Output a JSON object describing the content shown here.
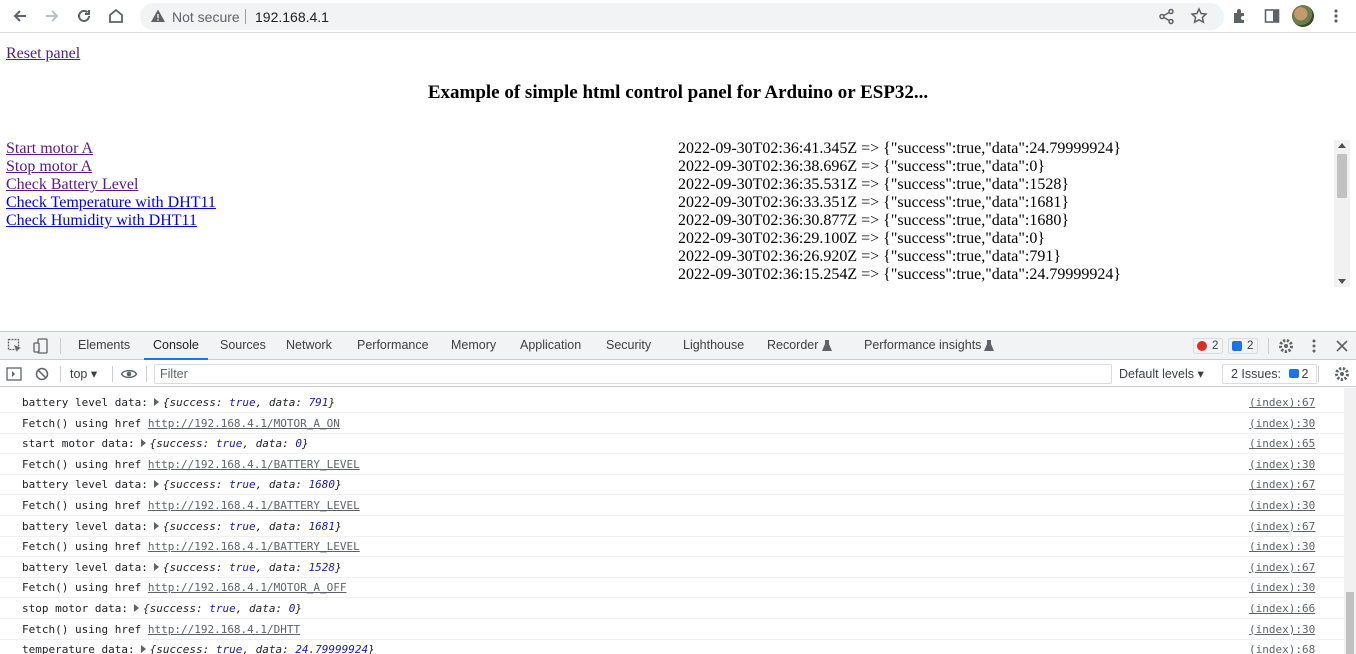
{
  "browser": {
    "not_secure": "Not secure",
    "url": "192.168.4.1"
  },
  "page": {
    "reset_link": "Reset panel",
    "title": "Example of simple html control panel for Arduino or ESP32...",
    "controls": [
      {
        "label": "Start motor A",
        "visited": true
      },
      {
        "label": "Stop motor A",
        "visited": true
      },
      {
        "label": "Check Battery Level",
        "visited": true
      },
      {
        "label": "Check Temperature with DHT11",
        "visited": false
      },
      {
        "label": "Check Humidity with DHT11",
        "visited": false
      }
    ],
    "log": [
      "2022-09-30T02:36:41.345Z => {\"success\":true,\"data\":24.79999924}",
      "2022-09-30T02:36:38.696Z => {\"success\":true,\"data\":0}",
      "2022-09-30T02:36:35.531Z => {\"success\":true,\"data\":1528}",
      "2022-09-30T02:36:33.351Z => {\"success\":true,\"data\":1681}",
      "2022-09-30T02:36:30.877Z => {\"success\":true,\"data\":1680}",
      "2022-09-30T02:36:29.100Z => {\"success\":true,\"data\":0}",
      "2022-09-30T02:36:26.920Z => {\"success\":true,\"data\":791}",
      "2022-09-30T02:36:15.254Z => {\"success\":true,\"data\":24.79999924}"
    ]
  },
  "devtools": {
    "tabs": [
      "Elements",
      "Console",
      "Sources",
      "Network",
      "Performance",
      "Memory",
      "Application",
      "Security",
      "Lighthouse",
      "Recorder",
      "Performance insights"
    ],
    "active_tab": "Console",
    "error_count": "2",
    "message_count": "2",
    "context": "top",
    "filter_placeholder": "Filter",
    "levels": "Default levels",
    "issues_label": "2 Issues:",
    "issues_count": "2",
    "console_rows": [
      {
        "kind": "obj",
        "label": "battery level data:",
        "data": "791",
        "src": "(index):67"
      },
      {
        "kind": "url",
        "label": "Fetch() using href",
        "url": "http://192.168.4.1/MOTOR_A_ON",
        "src": "(index):30"
      },
      {
        "kind": "obj",
        "label": "start motor data:",
        "data": "0",
        "src": "(index):65"
      },
      {
        "kind": "url",
        "label": "Fetch() using href",
        "url": "http://192.168.4.1/BATTERY_LEVEL",
        "src": "(index):30"
      },
      {
        "kind": "obj",
        "label": "battery level data:",
        "data": "1680",
        "src": "(index):67"
      },
      {
        "kind": "url",
        "label": "Fetch() using href",
        "url": "http://192.168.4.1/BATTERY_LEVEL",
        "src": "(index):30"
      },
      {
        "kind": "obj",
        "label": "battery level data:",
        "data": "1681",
        "src": "(index):67"
      },
      {
        "kind": "url",
        "label": "Fetch() using href",
        "url": "http://192.168.4.1/BATTERY_LEVEL",
        "src": "(index):30"
      },
      {
        "kind": "obj",
        "label": "battery level data:",
        "data": "1528",
        "src": "(index):67"
      },
      {
        "kind": "url",
        "label": "Fetch() using href",
        "url": "http://192.168.4.1/MOTOR_A_OFF",
        "src": "(index):30"
      },
      {
        "kind": "obj",
        "label": "stop motor data:",
        "data": "0",
        "src": "(index):66"
      },
      {
        "kind": "url",
        "label": "Fetch() using href",
        "url": "http://192.168.4.1/DHTT",
        "src": "(index):30"
      },
      {
        "kind": "obj",
        "label": "temperature data:",
        "data": "24.79999924",
        "src": "(index):68"
      }
    ]
  }
}
